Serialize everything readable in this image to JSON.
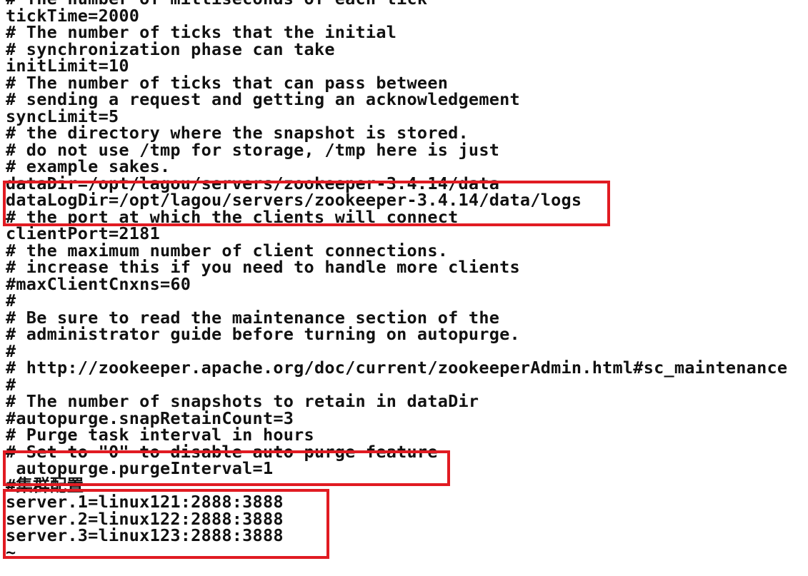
{
  "editor": {
    "lines": [
      "# The number of milliseconds of each tick",
      "tickTime=2000",
      "# The number of ticks that the initial",
      "# synchronization phase can take",
      "initLimit=10",
      "# The number of ticks that can pass between",
      "# sending a request and getting an acknowledgement",
      "syncLimit=5",
      "# the directory where the snapshot is stored.",
      "# do not use /tmp for storage, /tmp here is just",
      "# example sakes.",
      "dataDir=/opt/lagou/servers/zookeeper-3.4.14/data",
      "dataLogDir=/opt/lagou/servers/zookeeper-3.4.14/data/logs",
      "# the port at which the clients will connect",
      "clientPort=2181",
      "# the maximum number of client connections.",
      "# increase this if you need to handle more clients",
      "#maxClientCnxns=60",
      "#",
      "# Be sure to read the maintenance section of the",
      "# administrator guide before turning on autopurge.",
      "#",
      "# http://zookeeper.apache.org/doc/current/zookeeperAdmin.html#sc_maintenance",
      "#",
      "# The number of snapshots to retain in dataDir",
      "#autopurge.snapRetainCount=3",
      "# Purge task interval in hours",
      "# Set to \"0\" to disable auto purge feature",
      " autopurge.purgeInterval=1",
      "#集群配置",
      "server.1=linux121:2888:3888",
      "server.2=linux122:2888:3888",
      "server.3=linux123:2888:3888",
      "~"
    ]
  },
  "highlight_color": "#e11b22"
}
